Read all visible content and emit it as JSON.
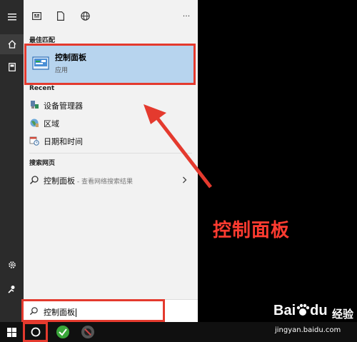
{
  "sections": {
    "best_match": "最佳匹配",
    "recent": "Recent",
    "web": "搜索网页"
  },
  "best_match": {
    "title": "控制面板",
    "subtitle": "应用"
  },
  "recent": [
    {
      "label": "设备管理器",
      "icon": "device-manager-icon"
    },
    {
      "label": "区域",
      "icon": "region-icon"
    },
    {
      "label": "日期和时间",
      "icon": "date-time-icon"
    }
  ],
  "web_result": {
    "label": "控制面板",
    "hint": " - 查看网络搜索结果"
  },
  "top_bar": {
    "more": "···"
  },
  "search": {
    "value": "控制面板"
  },
  "annotation": {
    "label": "控制面板"
  },
  "watermark": {
    "brand": "Bai",
    "brand2": "du",
    "jingyan": "经验",
    "url": "jingyan.baidu.com"
  },
  "colors": {
    "highlight": "#b7d4ee",
    "annotation_red": "#e43a2e",
    "rail": "#2b2b2b"
  }
}
